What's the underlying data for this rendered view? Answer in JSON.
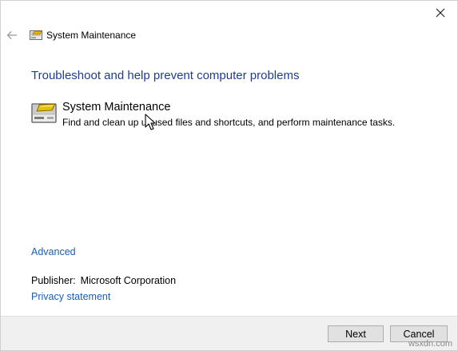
{
  "window": {
    "title": "System Maintenance"
  },
  "main": {
    "heading": "Troubleshoot and help prevent computer problems",
    "task": {
      "title": "System Maintenance",
      "description": "Find and clean up unused files and shortcuts, and perform maintenance tasks."
    },
    "advanced_label": "Advanced",
    "publisher_label": "Publisher:",
    "publisher_value": "Microsoft Corporation",
    "privacy_label": "Privacy statement"
  },
  "footer": {
    "next_label": "Next",
    "cancel_label": "Cancel",
    "watermark": "wsxdn.com"
  },
  "icons": {
    "close": "close-icon",
    "back": "back-arrow-icon",
    "title": "system-maintenance-icon",
    "task": "system-maintenance-icon"
  },
  "colors": {
    "heading": "#1e3d8f",
    "link": "#1a5fb4",
    "footer_bg": "#f0f0f0",
    "button_bg": "#e1e1e1"
  }
}
